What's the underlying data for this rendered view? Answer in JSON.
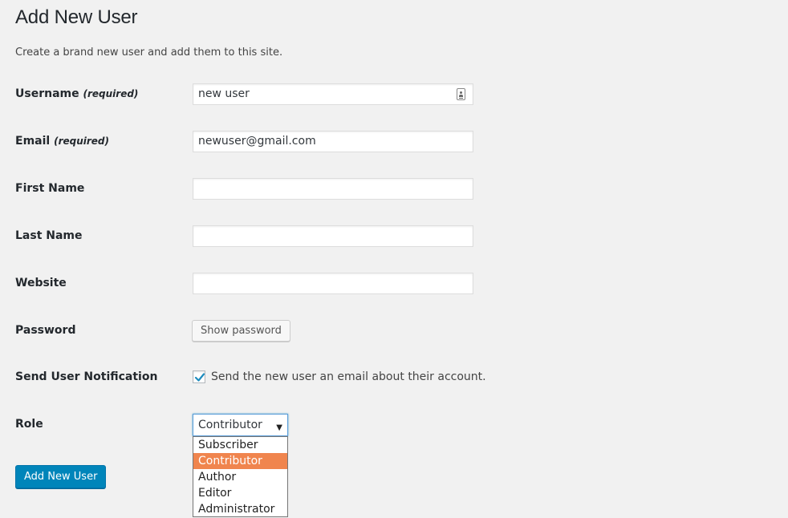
{
  "page": {
    "title": "Add New User",
    "intro": "Create a brand new user and add them to this site."
  },
  "fields": {
    "username": {
      "label": "Username",
      "required": "(required)",
      "value": "new user"
    },
    "email": {
      "label": "Email",
      "required": "(required)",
      "value": "newuser@gmail.com"
    },
    "first_name": {
      "label": "First Name",
      "value": ""
    },
    "last_name": {
      "label": "Last Name",
      "value": ""
    },
    "website": {
      "label": "Website",
      "value": ""
    },
    "password": {
      "label": "Password",
      "button_label": "Show password"
    },
    "notification": {
      "label": "Send User Notification",
      "checked": true,
      "checkbox_label": "Send the new user an email about their account."
    },
    "role": {
      "label": "Role",
      "selected": "Contributor",
      "options": [
        "Subscriber",
        "Contributor",
        "Author",
        "Editor",
        "Administrator"
      ]
    }
  },
  "actions": {
    "submit_label": "Add New User"
  },
  "colors": {
    "primary_button": "#0085ba",
    "selected_option": "#f0854e",
    "checkmark": "#1e8cbe",
    "background": "#f1f1f1"
  },
  "icons": {
    "username_field": "contact-card-icon",
    "checkbox": "checkmark-icon",
    "select": "caret-down-icon"
  }
}
